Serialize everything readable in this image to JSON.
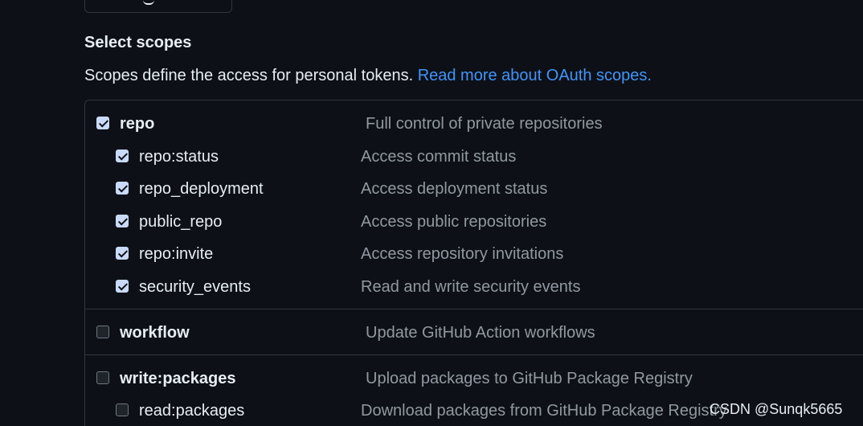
{
  "section": {
    "title": "Select scopes",
    "description": "Scopes define the access for personal tokens. ",
    "link_text": "Read more about OAuth scopes."
  },
  "scopes": [
    {
      "name": "repo",
      "description": "Full control of private repositories",
      "checked": true
    },
    {
      "name": "repo:status",
      "description": "Access commit status",
      "checked": true
    },
    {
      "name": "repo_deployment",
      "description": "Access deployment status",
      "checked": true
    },
    {
      "name": "public_repo",
      "description": "Access public repositories",
      "checked": true
    },
    {
      "name": "repo:invite",
      "description": "Access repository invitations",
      "checked": true
    },
    {
      "name": "security_events",
      "description": "Read and write security events",
      "checked": true
    },
    {
      "name": "workflow",
      "description": "Update GitHub Action workflows",
      "checked": false
    },
    {
      "name": "write:packages",
      "description": "Upload packages to GitHub Package Registry",
      "checked": false
    },
    {
      "name": "read:packages",
      "description": "Download packages from GitHub Package Registry",
      "checked": false
    }
  ],
  "watermark": "CSDN @Sunqk5665",
  "colors": {
    "background": "#0d1117",
    "link": "#4493f8",
    "border": "#30363d",
    "muted_text": "#9198a1",
    "checkbox_checked": "#c9daf8"
  }
}
